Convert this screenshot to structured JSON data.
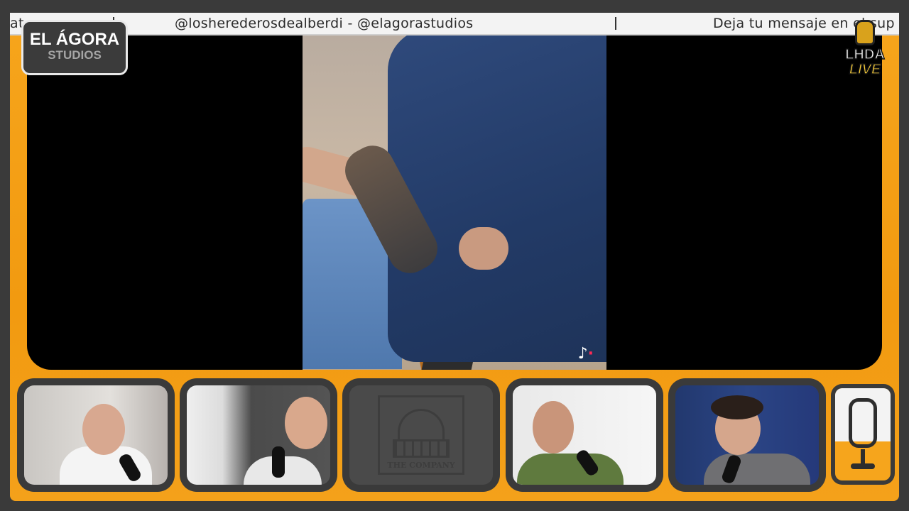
{
  "ticker": {
    "seg_left": "at",
    "handles": "@losherederosdealberdi   -   @elagorastudios",
    "message": "Deja tu mensaje en el sup"
  },
  "logo_left": {
    "line1": "EL ÁGORA",
    "line2": "STUDIOS"
  },
  "logo_right": {
    "line1": "LHDA",
    "line2": "LIVE"
  },
  "video": {
    "watermark_icon": "tiktok-icon"
  },
  "placeholder_tile": {
    "caption": "THE COMPANY"
  },
  "colors": {
    "frame": "#f6a51c",
    "tile_border": "#3a3a3a",
    "stage": "#000000"
  }
}
